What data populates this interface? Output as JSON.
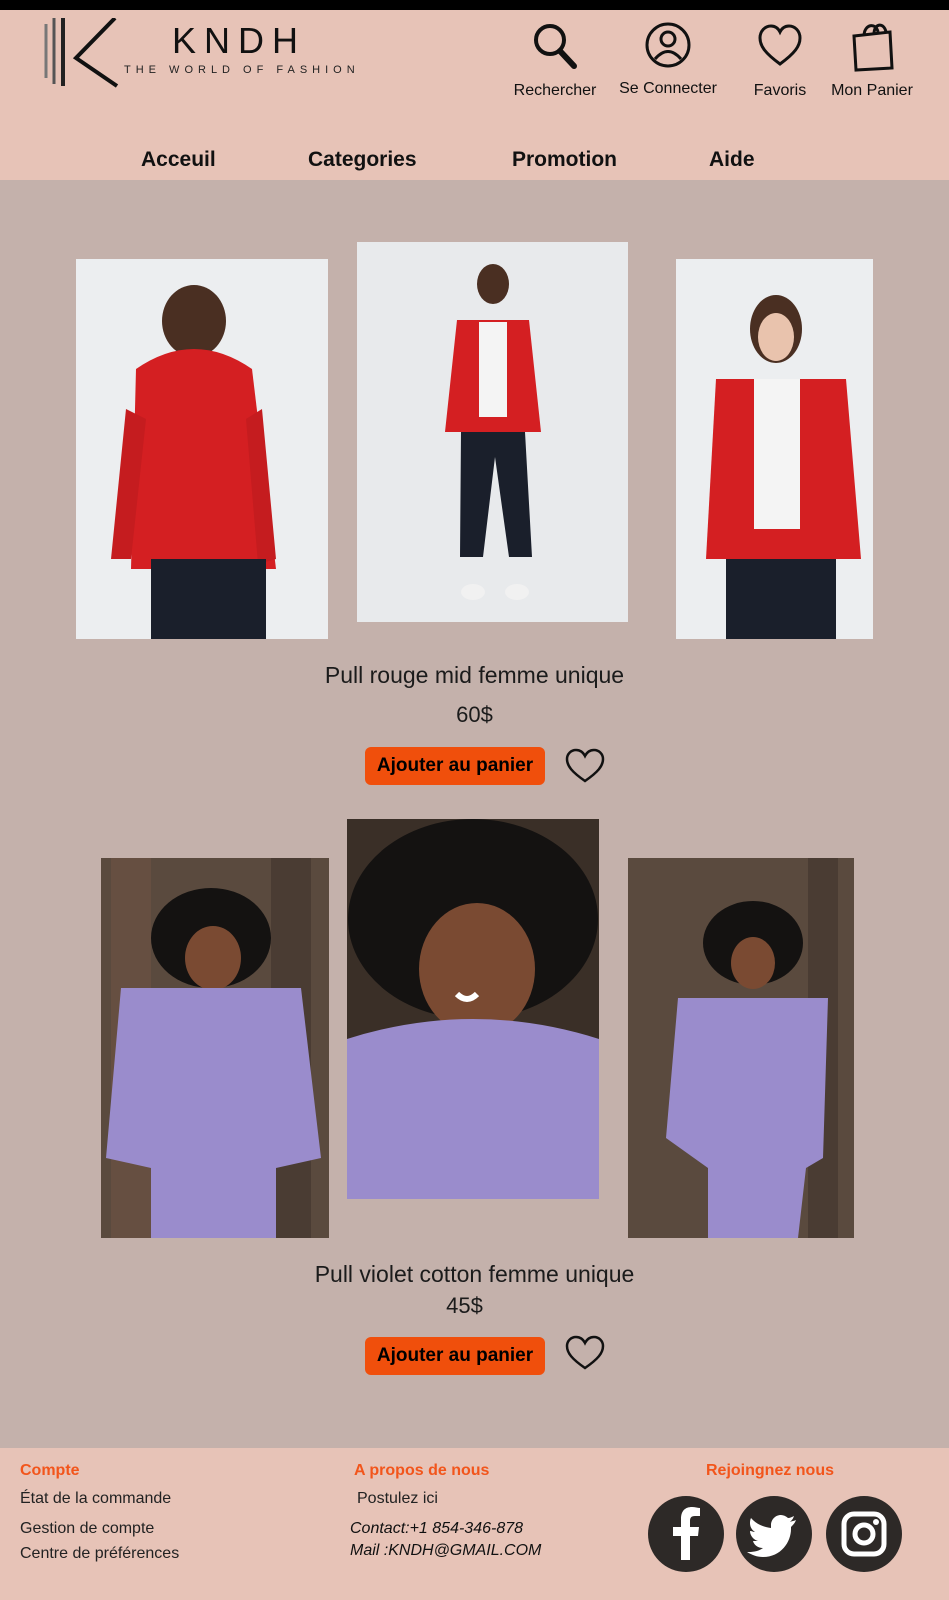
{
  "header": {
    "logo_text": "KNDH",
    "logo_tagline": "THE WORLD OF FASHION",
    "actions": [
      {
        "label": "Rechercher",
        "icon": "search-icon"
      },
      {
        "label": "Se Connecter",
        "icon": "user-icon"
      },
      {
        "label": "Favoris",
        "icon": "heart-icon"
      },
      {
        "label": "Mon Panier",
        "icon": "shopping-bag-icon"
      }
    ]
  },
  "nav": {
    "items": [
      {
        "label": "Acceuil"
      },
      {
        "label": "Categories"
      },
      {
        "label": "Promotion"
      },
      {
        "label": "Aide"
      }
    ]
  },
  "products": [
    {
      "title": "Pull rouge mid femme unique",
      "price": "60$",
      "add_to_cart": "Ajouter au panier",
      "photo_color": "#d41f22"
    },
    {
      "title": "Pull violet cotton femme unique",
      "price": "45$",
      "add_to_cart": "Ajouter au panier",
      "photo_color": "#9a8ccc"
    }
  ],
  "footer": {
    "account": {
      "heading": "Compte",
      "links": [
        "État de la commande",
        "Gestion de compte",
        "Centre de préférences"
      ]
    },
    "about": {
      "heading": "A propos de nous",
      "link": "Postulez ici",
      "contact": "Contact:+1 854-346-878",
      "mail": "Mail :KNDH@GMAIL.COM"
    },
    "social": {
      "heading": "Rejoingnez nous",
      "icons": [
        "facebook-icon",
        "twitter-icon",
        "instagram-icon"
      ]
    }
  },
  "colors": {
    "header_bg": "#e7c3b7",
    "page_bg": "#c4b1ab",
    "accent": "#f04f0c",
    "footer_heading": "#f2551b"
  }
}
